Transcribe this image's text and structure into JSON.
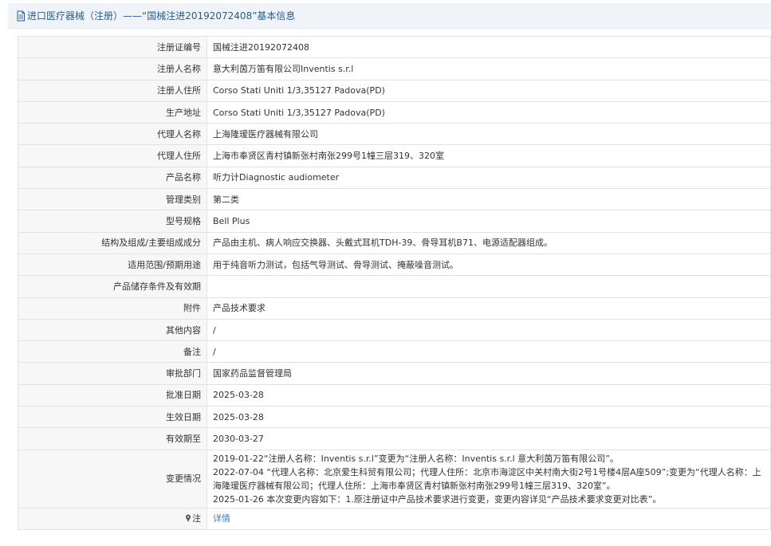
{
  "header": {
    "title": "进口医疗器械（注册）——“国械注进20192072408”基本信息"
  },
  "rows": [
    {
      "label": "注册证编号",
      "value": "国械注进20192072408"
    },
    {
      "label": "注册人名称",
      "value": "意大利茵万笛有限公司Inventis s.r.l"
    },
    {
      "label": "注册人住所",
      "value": "Corso Stati Uniti 1/3,35127 Padova(PD)"
    },
    {
      "label": "生产地址",
      "value": "Corso Stati Uniti 1/3,35127 Padova(PD)"
    },
    {
      "label": "代理人名称",
      "value": "上海隆瑷医疗器械有限公司"
    },
    {
      "label": "代理人住所",
      "value": "上海市奉贤区青村镇新张村南张299号1幢三层319、320室"
    },
    {
      "label": "产品名称",
      "value": "听力计Diagnostic audiometer"
    },
    {
      "label": "管理类别",
      "value": "第二类"
    },
    {
      "label": "型号规格",
      "value": "Bell Plus"
    },
    {
      "label": "结构及组成/主要组成成分",
      "value": "产品由主机、病人响应交换器、头戴式耳机TDH-39、骨导耳机B71、电源适配器组成。"
    },
    {
      "label": "适用范围/预期用途",
      "value": "用于纯音听力测试，包括气导测试、骨导测试、掩蔽噪音测试。"
    },
    {
      "label": "产品储存条件及有效期",
      "value": ""
    },
    {
      "label": "附件",
      "value": "产品技术要求"
    },
    {
      "label": "其他内容",
      "value": "/"
    },
    {
      "label": "备注",
      "value": "/"
    },
    {
      "label": "审批部门",
      "value": "国家药品监督管理局"
    },
    {
      "label": "批准日期",
      "value": "2025-03-28"
    },
    {
      "label": "生效日期",
      "value": "2025-03-28"
    },
    {
      "label": "有效期至",
      "value": "2030-03-27"
    }
  ],
  "changes": {
    "label": "变更情况",
    "lines": [
      "2019-01-22“注册人名称：Inventis s.r.l”变更为“注册人名称：Inventis s.r.l 意大利茵万笛有限公司”。",
      "2022-07-04 “代理人名称：北京爱生科贸有限公司；代理人住所：北京市海淀区中关村南大街2号1号楼4层A座509”;变更为“代理人名称：上海隆瑷医疗器械有限公司；代理人住所：上海市奉贤区青村镇新张村南张299号1幢三层319、320室”。",
      "2025-01-26 本次变更内容如下：1.原注册证中产品技术要求进行变更，变更内容详见“产品技术要求变更对比表”。"
    ]
  },
  "note": {
    "label": "注",
    "link_text": "详情",
    "icon": "pin-icon"
  },
  "colors": {
    "title": "#2a5a8c",
    "link": "#3b7ec8",
    "label_bg": "#f7f7f7",
    "border": "#e3e3e3"
  }
}
